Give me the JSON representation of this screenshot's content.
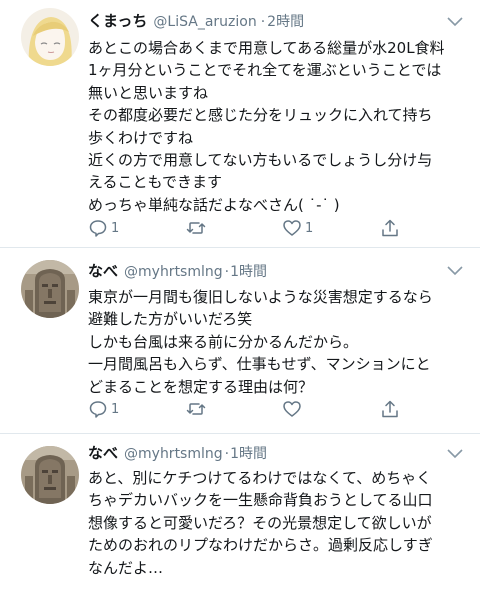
{
  "tweets": [
    {
      "name": "くまっち",
      "handle": "@LiSA_aruzion",
      "sep": "·",
      "time": "2時間",
      "lines": [
        "あとこの場合あくまで用意してある総量が水20L食料",
        "1ヶ月分ということでそれ全てを運ぶということでは",
        "無いと思いますね",
        "その都度必要だと感じた分をリュックに入れて持ち",
        "歩くわけですね",
        "近くの方で用意してない方もいるでしょうし分け与",
        "えることもできます",
        "めっちゃ単純な話だよなべさん( ˙-˙ )"
      ],
      "reply_count": "1",
      "retweet_count": "",
      "like_count": "1"
    },
    {
      "name": "なべ",
      "handle": "@myhrtsmlng",
      "sep": "·",
      "time": "1時間",
      "lines": [
        "東京が一月間も復旧しないような災害想定するなら",
        "避難した方がいいだろ笑",
        "しかも台風は来る前に分かるんだから。",
        "一月間風呂も入らず、仕事もせず、マンションにと",
        "どまることを想定する理由は何？"
      ],
      "reply_count": "1",
      "retweet_count": "",
      "like_count": ""
    },
    {
      "name": "なべ",
      "handle": "@myhrtsmlng",
      "sep": "·",
      "time": "1時間",
      "lines": [
        "あと、別にケチつけてるわけではなくて、めちゃく",
        "ちゃデカいバックを一生懸命背負おうとしてる山口",
        "想像すると可愛いだろ？その光景想定して欲しいが",
        "ためのおれのリプなわけだからさ。過剰反応しすぎ",
        "なんだよ…"
      ]
    }
  ],
  "colors": {
    "icon": "#657786",
    "text": "#14171a",
    "border": "#e1e8ed"
  }
}
